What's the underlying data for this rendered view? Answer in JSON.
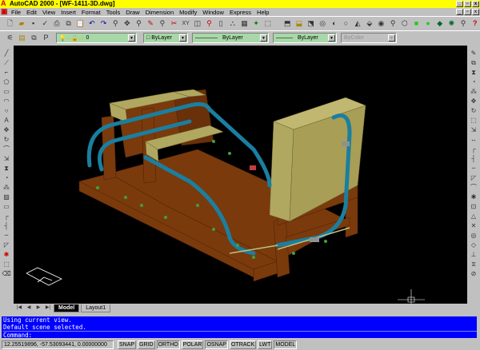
{
  "window": {
    "title": "AutoCAD 2000 - [WF-1411-3D.dwg]",
    "buttons": [
      "_",
      "▫",
      "x"
    ]
  },
  "menu": [
    "File",
    "Edit",
    "View",
    "Insert",
    "Format",
    "Tools",
    "Draw",
    "Dimension",
    "Modify",
    "Window",
    "Express",
    "Help"
  ],
  "layers": {
    "layer_value": "0",
    "color_value": "ByLayer",
    "linetype_value": "ByLayer",
    "lineweight_value": "ByLayer",
    "plotstyle_value": "ByColor",
    "p_label": "P"
  },
  "tabs": {
    "model": "Model",
    "layout": "Layout1"
  },
  "command": {
    "history": [
      "Using current view.",
      "Default scene selected."
    ],
    "prompt": "Command:"
  },
  "status": {
    "coords": "12.25519896, -57.53093441, 0.00000000",
    "buttons": [
      "SNAP",
      "GRID",
      "ORTHO",
      "POLAR",
      "OSNAP",
      "OTRACK",
      "LWT",
      "MODEL"
    ],
    "active": [
      "ORTHO",
      "OSNAP",
      "MODEL"
    ]
  },
  "colors": {
    "title_bar": "#ffff00",
    "command_bg": "#0000ff",
    "frame": "#7a3a0c",
    "plate": "#b0a860",
    "tube": "#1a7fa0"
  }
}
